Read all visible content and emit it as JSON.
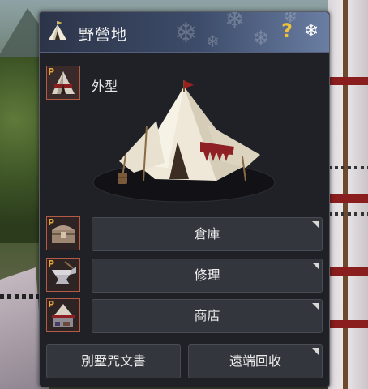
{
  "window": {
    "title": "野營地",
    "help_symbol": "?",
    "close_symbol": "❄"
  },
  "preview": {
    "label": "外型",
    "badge": "P",
    "icon": "tent-thumbnail-icon"
  },
  "menu": [
    {
      "label": "倉庫",
      "badge": "P",
      "icon": "treasure-chest-icon"
    },
    {
      "label": "修理",
      "badge": "P",
      "icon": "anvil-icon"
    },
    {
      "label": "商店",
      "badge": "P",
      "icon": "merchant-tent-icon"
    }
  ],
  "bottom_buttons": [
    {
      "label": "別墅咒文書"
    },
    {
      "label": "遠端回收"
    }
  ],
  "colors": {
    "title_bar": "#3d4c6a",
    "panel": "#202127",
    "button": "#34363d",
    "slot_border": "#b35b45",
    "help_accent": "#f0c23a"
  }
}
